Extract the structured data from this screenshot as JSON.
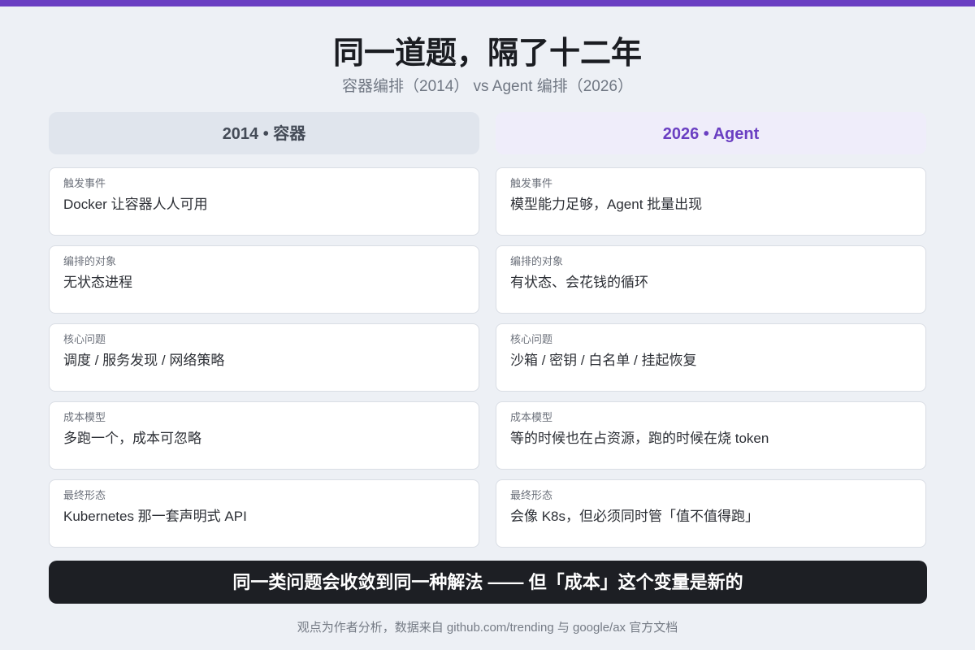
{
  "header": {
    "title": "同一道题，隔了十二年",
    "subtitle": "容器编排（2014） vs Agent 编排（2026）"
  },
  "left": {
    "heading": "2014 • 容器",
    "rows": [
      {
        "label": "触发事件",
        "value": "Docker 让容器人人可用"
      },
      {
        "label": "编排的对象",
        "value": "无状态进程"
      },
      {
        "label": "核心问题",
        "value": "调度 / 服务发现 / 网络策略"
      },
      {
        "label": "成本模型",
        "value": "多跑一个，成本可忽略"
      },
      {
        "label": "最终形态",
        "value": "Kubernetes 那一套声明式 API"
      }
    ]
  },
  "right": {
    "heading": "2026 • Agent",
    "rows": [
      {
        "label": "触发事件",
        "value": "模型能力足够，Agent 批量出现"
      },
      {
        "label": "编排的对象",
        "value": "有状态、会花钱的循环"
      },
      {
        "label": "核心问题",
        "value": "沙箱 / 密钥 / 白名单 / 挂起恢复"
      },
      {
        "label": "成本模型",
        "value": "等的时候也在占资源，跑的时候在烧 token"
      },
      {
        "label": "最终形态",
        "value": "会像 K8s，但必须同时管「值不值得跑」"
      }
    ]
  },
  "banner": "同一类问题会收敛到同一种解法 —— 但「成本」这个变量是新的",
  "footer": "观点为作者分析，数据来自 github.com/trending 与 google/ax 官方文档",
  "colors": {
    "accent": "#6a3fc2",
    "background": "#edf0f5",
    "banner": "#1d1f24"
  }
}
